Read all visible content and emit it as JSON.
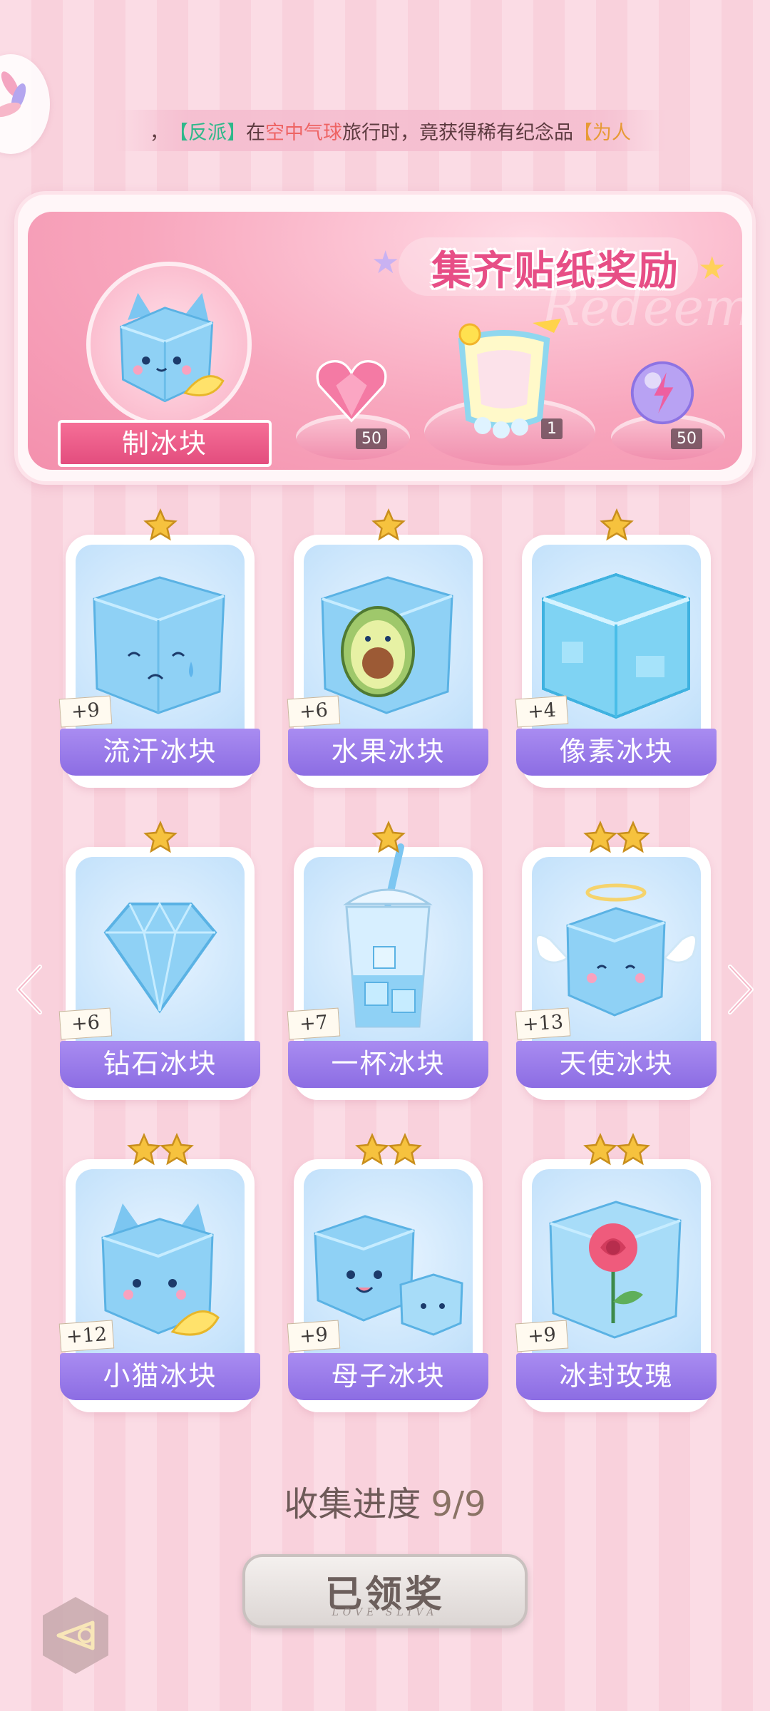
{
  "marquee": {
    "prefix": "，",
    "faction": "【反派】",
    "verb_in": "在",
    "location": "空中气球",
    "middle": "旅行时，竟获得稀有纪念品",
    "item": "【为人"
  },
  "banner": {
    "title": "集齐贴纸奖励",
    "watermark": "Redeem",
    "main_prize_label": "制冰块",
    "rewards": [
      {
        "icon": "pink-heart-gem-icon",
        "count": "50"
      },
      {
        "icon": "lemonade-frame-icon",
        "count": "1"
      },
      {
        "icon": "purple-lightning-orb-icon",
        "count": "50"
      }
    ]
  },
  "stickers": [
    {
      "name": "流汗冰块",
      "bonus": "+9",
      "stars": 1,
      "icon": "sweating-ice-cube-icon"
    },
    {
      "name": "水果冰块",
      "bonus": "+6",
      "stars": 1,
      "icon": "avocado-ice-cube-icon"
    },
    {
      "name": "像素冰块",
      "bonus": "+4",
      "stars": 1,
      "icon": "pixel-ice-cube-icon"
    },
    {
      "name": "钻石冰块",
      "bonus": "+6",
      "stars": 1,
      "icon": "diamond-ice-icon"
    },
    {
      "name": "一杯冰块",
      "bonus": "+7",
      "stars": 1,
      "icon": "cup-of-ice-icon"
    },
    {
      "name": "天使冰块",
      "bonus": "+13",
      "stars": 2,
      "icon": "angel-ice-cube-icon"
    },
    {
      "name": "小猫冰块",
      "bonus": "+12",
      "stars": 2,
      "icon": "cat-ice-cube-icon"
    },
    {
      "name": "母子冰块",
      "bonus": "+9",
      "stars": 2,
      "icon": "mother-child-ice-cube-icon"
    },
    {
      "name": "冰封玫瑰",
      "bonus": "+9",
      "stars": 2,
      "icon": "frozen-rose-icon"
    }
  ],
  "progress": {
    "label": "收集进度",
    "value": "9/9"
  },
  "claim_button": {
    "label": "已领奖",
    "sub": "LOVE SLIVA"
  },
  "colors": {
    "accent": "#e74e86",
    "label_purple": "#8c6de3",
    "star": "#f6c23e"
  }
}
